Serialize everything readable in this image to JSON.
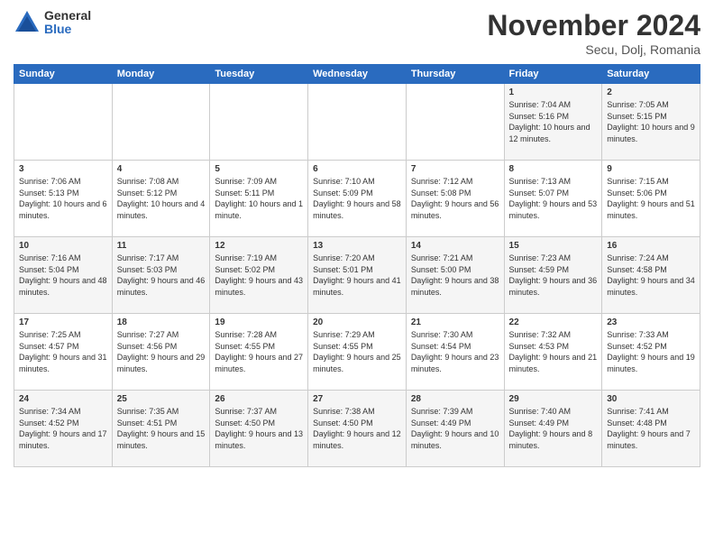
{
  "logo": {
    "general": "General",
    "blue": "Blue"
  },
  "header": {
    "month": "November 2024",
    "location": "Secu, Dolj, Romania"
  },
  "weekdays": [
    "Sunday",
    "Monday",
    "Tuesday",
    "Wednesday",
    "Thursday",
    "Friday",
    "Saturday"
  ],
  "weeks": [
    [
      {
        "day": "",
        "info": ""
      },
      {
        "day": "",
        "info": ""
      },
      {
        "day": "",
        "info": ""
      },
      {
        "day": "",
        "info": ""
      },
      {
        "day": "",
        "info": ""
      },
      {
        "day": "1",
        "info": "Sunrise: 7:04 AM\nSunset: 5:16 PM\nDaylight: 10 hours and 12 minutes."
      },
      {
        "day": "2",
        "info": "Sunrise: 7:05 AM\nSunset: 5:15 PM\nDaylight: 10 hours and 9 minutes."
      }
    ],
    [
      {
        "day": "3",
        "info": "Sunrise: 7:06 AM\nSunset: 5:13 PM\nDaylight: 10 hours and 6 minutes."
      },
      {
        "day": "4",
        "info": "Sunrise: 7:08 AM\nSunset: 5:12 PM\nDaylight: 10 hours and 4 minutes."
      },
      {
        "day": "5",
        "info": "Sunrise: 7:09 AM\nSunset: 5:11 PM\nDaylight: 10 hours and 1 minute."
      },
      {
        "day": "6",
        "info": "Sunrise: 7:10 AM\nSunset: 5:09 PM\nDaylight: 9 hours and 58 minutes."
      },
      {
        "day": "7",
        "info": "Sunrise: 7:12 AM\nSunset: 5:08 PM\nDaylight: 9 hours and 56 minutes."
      },
      {
        "day": "8",
        "info": "Sunrise: 7:13 AM\nSunset: 5:07 PM\nDaylight: 9 hours and 53 minutes."
      },
      {
        "day": "9",
        "info": "Sunrise: 7:15 AM\nSunset: 5:06 PM\nDaylight: 9 hours and 51 minutes."
      }
    ],
    [
      {
        "day": "10",
        "info": "Sunrise: 7:16 AM\nSunset: 5:04 PM\nDaylight: 9 hours and 48 minutes."
      },
      {
        "day": "11",
        "info": "Sunrise: 7:17 AM\nSunset: 5:03 PM\nDaylight: 9 hours and 46 minutes."
      },
      {
        "day": "12",
        "info": "Sunrise: 7:19 AM\nSunset: 5:02 PM\nDaylight: 9 hours and 43 minutes."
      },
      {
        "day": "13",
        "info": "Sunrise: 7:20 AM\nSunset: 5:01 PM\nDaylight: 9 hours and 41 minutes."
      },
      {
        "day": "14",
        "info": "Sunrise: 7:21 AM\nSunset: 5:00 PM\nDaylight: 9 hours and 38 minutes."
      },
      {
        "day": "15",
        "info": "Sunrise: 7:23 AM\nSunset: 4:59 PM\nDaylight: 9 hours and 36 minutes."
      },
      {
        "day": "16",
        "info": "Sunrise: 7:24 AM\nSunset: 4:58 PM\nDaylight: 9 hours and 34 minutes."
      }
    ],
    [
      {
        "day": "17",
        "info": "Sunrise: 7:25 AM\nSunset: 4:57 PM\nDaylight: 9 hours and 31 minutes."
      },
      {
        "day": "18",
        "info": "Sunrise: 7:27 AM\nSunset: 4:56 PM\nDaylight: 9 hours and 29 minutes."
      },
      {
        "day": "19",
        "info": "Sunrise: 7:28 AM\nSunset: 4:55 PM\nDaylight: 9 hours and 27 minutes."
      },
      {
        "day": "20",
        "info": "Sunrise: 7:29 AM\nSunset: 4:55 PM\nDaylight: 9 hours and 25 minutes."
      },
      {
        "day": "21",
        "info": "Sunrise: 7:30 AM\nSunset: 4:54 PM\nDaylight: 9 hours and 23 minutes."
      },
      {
        "day": "22",
        "info": "Sunrise: 7:32 AM\nSunset: 4:53 PM\nDaylight: 9 hours and 21 minutes."
      },
      {
        "day": "23",
        "info": "Sunrise: 7:33 AM\nSunset: 4:52 PM\nDaylight: 9 hours and 19 minutes."
      }
    ],
    [
      {
        "day": "24",
        "info": "Sunrise: 7:34 AM\nSunset: 4:52 PM\nDaylight: 9 hours and 17 minutes."
      },
      {
        "day": "25",
        "info": "Sunrise: 7:35 AM\nSunset: 4:51 PM\nDaylight: 9 hours and 15 minutes."
      },
      {
        "day": "26",
        "info": "Sunrise: 7:37 AM\nSunset: 4:50 PM\nDaylight: 9 hours and 13 minutes."
      },
      {
        "day": "27",
        "info": "Sunrise: 7:38 AM\nSunset: 4:50 PM\nDaylight: 9 hours and 12 minutes."
      },
      {
        "day": "28",
        "info": "Sunrise: 7:39 AM\nSunset: 4:49 PM\nDaylight: 9 hours and 10 minutes."
      },
      {
        "day": "29",
        "info": "Sunrise: 7:40 AM\nSunset: 4:49 PM\nDaylight: 9 hours and 8 minutes."
      },
      {
        "day": "30",
        "info": "Sunrise: 7:41 AM\nSunset: 4:48 PM\nDaylight: 9 hours and 7 minutes."
      }
    ]
  ]
}
